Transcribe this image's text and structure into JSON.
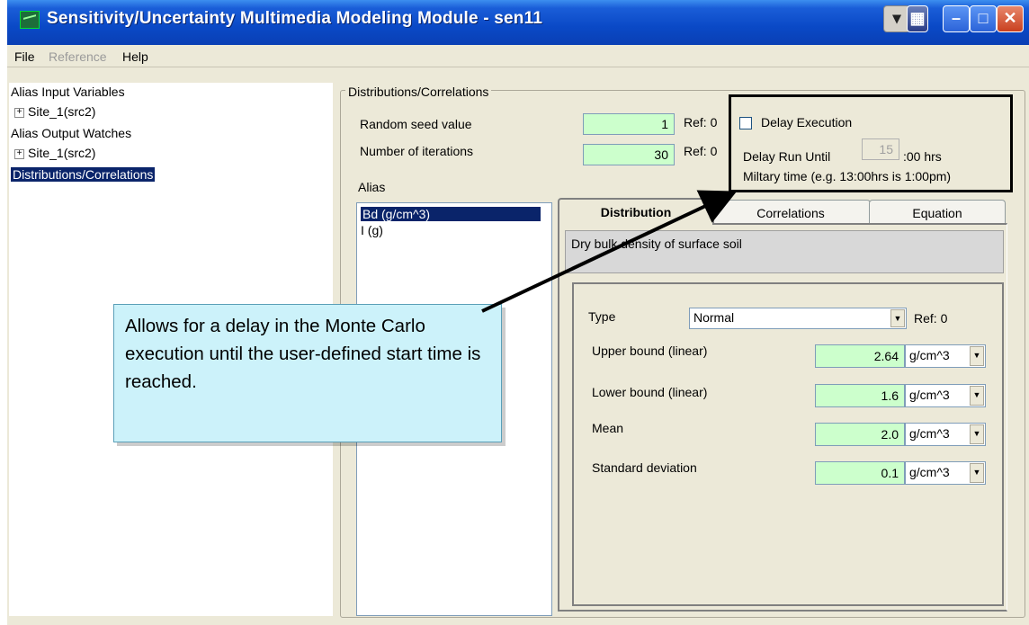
{
  "window": {
    "title": "Sensitivity/Uncertainty Multimedia Modeling Module - sen11",
    "minimize_glyph": "–",
    "maximize_glyph": "□",
    "close_glyph": "✕"
  },
  "menu": [
    {
      "label": "File",
      "disabled": false
    },
    {
      "label": "Reference",
      "disabled": true
    },
    {
      "label": "Help",
      "disabled": false
    }
  ],
  "tree": {
    "items": [
      {
        "label": "Alias Input Variables",
        "level": 0
      },
      {
        "label": "Site_1(src2)",
        "level": 1,
        "expander": "+"
      },
      {
        "label": "Alias Output Watches",
        "level": 0
      },
      {
        "label": "Site_1(src2)",
        "level": 1,
        "expander": "+"
      },
      {
        "label": "Distributions/Correlations",
        "level": 0,
        "selected": true
      }
    ]
  },
  "panel": {
    "group_title": "Distributions/Correlations",
    "seed_label": "Random seed value",
    "seed_value": "1",
    "seed_ref": "Ref: 0",
    "iterations_label": "Number of iterations",
    "iterations_value": "30",
    "iterations_ref": "Ref: 0",
    "delay_label": "Delay Execution",
    "delay_checked": false,
    "delay_run_label": "Delay Run Until",
    "delay_hour": "15",
    "delay_suffix": ":00 hrs",
    "military_note": "Miltary time (e.g. 13:00hrs is 1:00pm)"
  },
  "alias": {
    "label": "Alias",
    "items": [
      {
        "label": "Bd  (g/cm^3)",
        "selected": true
      },
      {
        "label": "I  (g)",
        "selected": false
      }
    ]
  },
  "tabs": [
    {
      "label": "Distribution",
      "active": true
    },
    {
      "label": "Correlations",
      "active": false
    },
    {
      "label": "Equation",
      "active": false
    }
  ],
  "distribution": {
    "description": "Dry bulk density of surface soil",
    "type_label": "Type",
    "type_value": "Normal",
    "type_ref": "Ref: 0",
    "params": [
      {
        "label": "Upper bound (linear)",
        "value": "2.64",
        "unit": "g/cm^3"
      },
      {
        "label": "Lower bound (linear)",
        "value": "1.6",
        "unit": "g/cm^3"
      },
      {
        "label": "Mean",
        "value": "2.0",
        "unit": "g/cm^3"
      },
      {
        "label": "Standard deviation",
        "value": "0.1",
        "unit": "g/cm^3"
      }
    ]
  },
  "callout": {
    "text": "Allows for a delay in the Monte Carlo execution until the user-defined start time is reached."
  },
  "colors": {
    "title_bar": "#0a49c6",
    "selection": "#0a246a",
    "input_green": "#ccffcc",
    "callout_bg": "#ccf2fa"
  }
}
